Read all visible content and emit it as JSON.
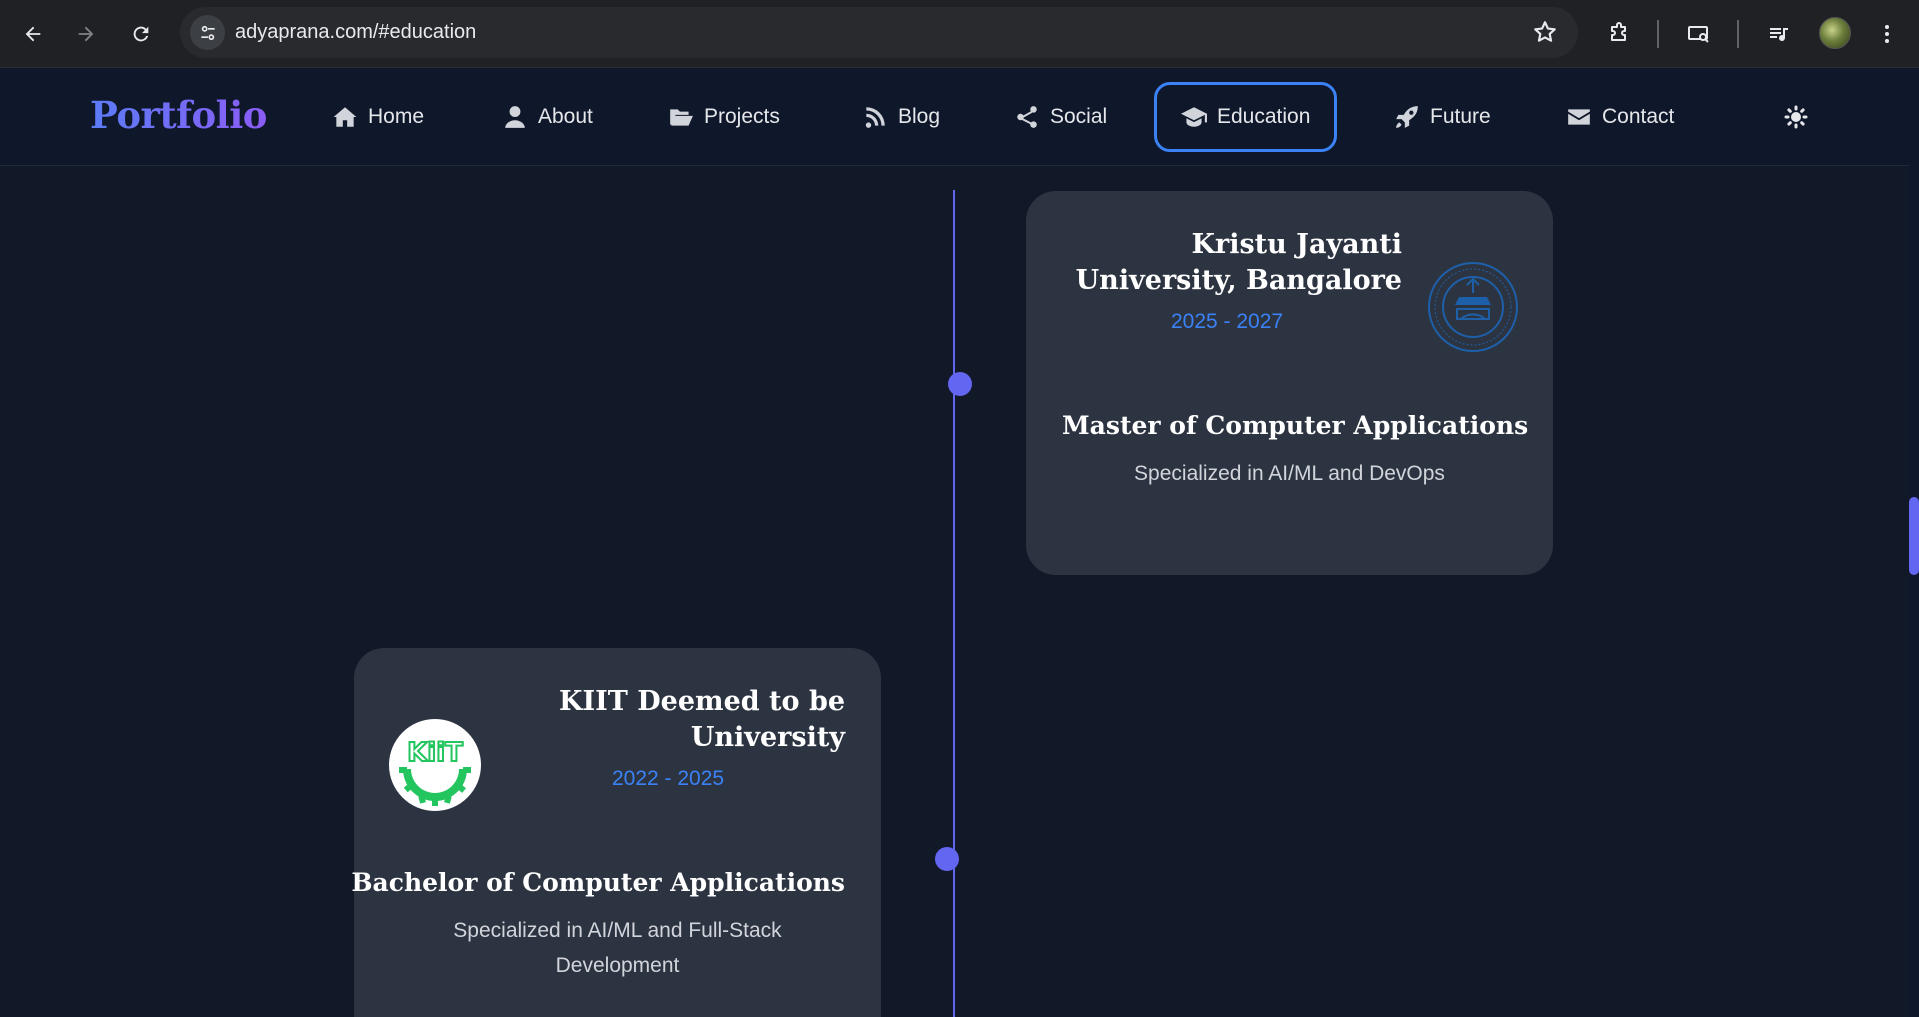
{
  "browser": {
    "url": "adyaprana.com/#education"
  },
  "navbar": {
    "brand": "Portfolio",
    "items": [
      {
        "label": "Home",
        "icon": "home-icon"
      },
      {
        "label": "About",
        "icon": "user-icon"
      },
      {
        "label": "Projects",
        "icon": "folder-open-icon"
      },
      {
        "label": "Blog",
        "icon": "blog-icon"
      },
      {
        "label": "Social",
        "icon": "share-icon"
      },
      {
        "label": "Education",
        "icon": "graduation-cap-icon",
        "active": true
      },
      {
        "label": "Future",
        "icon": "rocket-icon"
      },
      {
        "label": "Contact",
        "icon": "envelope-icon"
      }
    ],
    "theme_toggle_icon": "sun-icon"
  },
  "education": [
    {
      "institution": "Kristu Jayanti University, Bangalore",
      "institution_line1": "Kristu Jayanti",
      "institution_line2": "University, Bangalore",
      "years": "2025 - 2027",
      "degree": "Master of Computer Applications",
      "specialization": "Specialized in AI/ML and DevOps",
      "logo_icon": "kristu-jayanti-seal-logo"
    },
    {
      "institution": "KIIT Deemed to be University",
      "institution_line1": "KIIT Deemed to be",
      "institution_line2": "University",
      "years": "2022 - 2025",
      "degree": "Bachelor of Computer Applications",
      "specialization_line1": "Specialized in AI/ML and Full-Stack",
      "specialization_line2": "Development",
      "logo_icon": "kiit-logo",
      "logo_text": "KiiT"
    }
  ],
  "colors": {
    "page_bg": "#111827",
    "card_bg": "#2d3441",
    "accent": "#3b82f6",
    "timeline": "#6366f1"
  }
}
